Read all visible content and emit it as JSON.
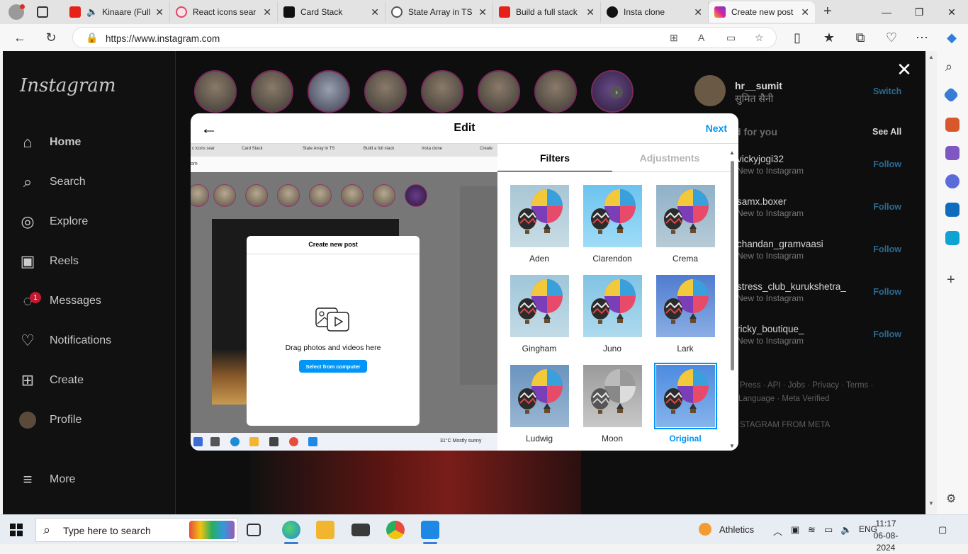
{
  "browser": {
    "tabs": [
      {
        "label": "Kinaare (Full",
        "icon": "youtube-icon",
        "color": "#e62117"
      },
      {
        "label": "React icons sear",
        "icon": "react-icon",
        "color": "#d94a6a"
      },
      {
        "label": "Card Stack",
        "icon": "codepen-icon",
        "color": "#111111"
      },
      {
        "label": "State Array in TS",
        "icon": "chatgpt-icon",
        "color": "#555555"
      },
      {
        "label": "Build a full stack",
        "icon": "youtube-icon",
        "color": "#e62117"
      },
      {
        "label": "Insta clone",
        "icon": "vercel-icon",
        "color": "#111111"
      },
      {
        "label": "Create new post",
        "icon": "instagram-icon",
        "color": "#d6249f"
      }
    ],
    "url": "https://www.instagram.com"
  },
  "instagram": {
    "logo": "Instagram",
    "nav": [
      {
        "label": "Home",
        "icon": "home-icon"
      },
      {
        "label": "Search",
        "icon": "search-icon"
      },
      {
        "label": "Explore",
        "icon": "compass-icon"
      },
      {
        "label": "Reels",
        "icon": "reels-icon"
      },
      {
        "label": "Messages",
        "icon": "messenger-icon",
        "badge": "1"
      },
      {
        "label": "Notifications",
        "icon": "heart-icon"
      },
      {
        "label": "Create",
        "icon": "plus-square-icon"
      },
      {
        "label": "Profile",
        "icon": "avatar-icon"
      },
      {
        "label": "More",
        "icon": "menu-icon"
      }
    ],
    "profile": {
      "username": "hr__sumit",
      "fullname": "सुमित सैनी",
      "switch": "Switch"
    },
    "suggested_header": "d for you",
    "see_all": "See All",
    "suggestions": [
      {
        "name": "vickyjogi32",
        "sub": "New to Instagram",
        "action": "Follow"
      },
      {
        "name": "samx.boxer",
        "sub": "New to Instagram",
        "action": "Follow"
      },
      {
        "name": "chandan_gramvaasi",
        "sub": "New to Instagram",
        "action": "Follow"
      },
      {
        "name": "stress_club_kurukshetra_",
        "sub": "New to Instagram",
        "action": "Follow"
      },
      {
        "name": "ricky_boutique_",
        "sub": "New to Instagram",
        "action": "Follow"
      }
    ],
    "footer_links": "· Press · API · Jobs · Privacy · Terms ·",
    "footer_links2": "Language · Meta Verified",
    "copyright": "STAGRAM FROM META"
  },
  "modal": {
    "title": "Edit",
    "next": "Next",
    "tabs": {
      "filters": "Filters",
      "adjustments": "Adjustments"
    },
    "filters": [
      {
        "name": "Aden",
        "selected": false
      },
      {
        "name": "Clarendon",
        "selected": false
      },
      {
        "name": "Crema",
        "selected": false
      },
      {
        "name": "Gingham",
        "selected": false
      },
      {
        "name": "Juno",
        "selected": false
      },
      {
        "name": "Lark",
        "selected": false
      },
      {
        "name": "Ludwig",
        "selected": false
      },
      {
        "name": "Moon",
        "selected": false
      },
      {
        "name": "Original",
        "selected": true
      }
    ],
    "preview": {
      "tabs": [
        "c icons sear",
        "Card Stack",
        "State Array in TS",
        "Build a full stack",
        "Insta clone",
        "Create"
      ],
      "url": "om",
      "inner_title": "Create new post",
      "drag_text": "Drag photos and videos here",
      "select_button": "Select from computer",
      "weather": "31°C  Mostly sunny"
    }
  },
  "taskbar": {
    "search_placeholder": "Type here to search",
    "weather_label": "Athletics",
    "lang": "ENG",
    "time": "11:17",
    "date": "06-08-2024"
  },
  "colors": {
    "accent": "#0095f6",
    "ig_dim_bg": "#0e0e0e"
  }
}
